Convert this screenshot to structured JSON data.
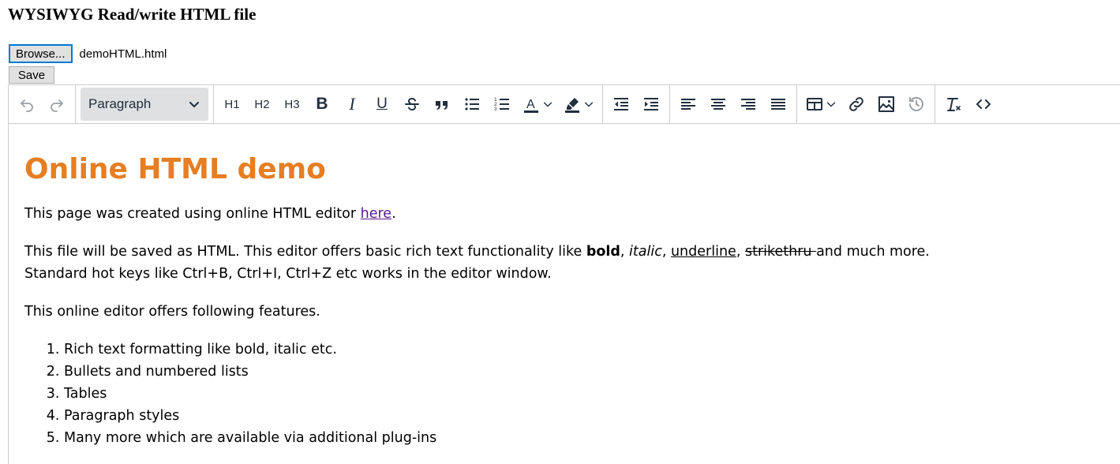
{
  "page": {
    "title": "WYSIWYG Read/write HTML file"
  },
  "file": {
    "browse_label": "Browse...",
    "file_name": "demoHTML.html",
    "save_label": "Save"
  },
  "toolbar": {
    "format_value": "Paragraph",
    "h1": "H1",
    "h2": "H2",
    "h3": "H3",
    "bold": "B",
    "italic": "I",
    "underline": "U",
    "text_color_letter": "A"
  },
  "content": {
    "heading": "Online HTML demo",
    "p1_text": "This page was created using online HTML editor ",
    "p1_link": "here",
    "p1_end": ".",
    "p2_a": "This file will be saved as HTML. This editor offers basic rich text functionality like ",
    "p2_bold": "bold",
    "p2_sep1": ", ",
    "p2_italic": "italic",
    "p2_sep2": ", ",
    "p2_underline": "underline",
    "p2_sep3": ", ",
    "p2_strike": "strikethru ",
    "p2_end": "and much more.",
    "p2_line2": "Standard hot keys like Ctrl+B, Ctrl+I, Ctrl+Z etc works in the editor window.",
    "p3": "This online editor offers following features.",
    "features": [
      "Rich text formatting like bold, italic etc.",
      "Bullets and numbered lists",
      "Tables",
      "Paragraph styles",
      "Many more which are available via additional plug-ins"
    ]
  },
  "colors": {
    "heading": "#e67e23",
    "link": "#551a8b",
    "toolbar_icon": "#222f3e"
  }
}
